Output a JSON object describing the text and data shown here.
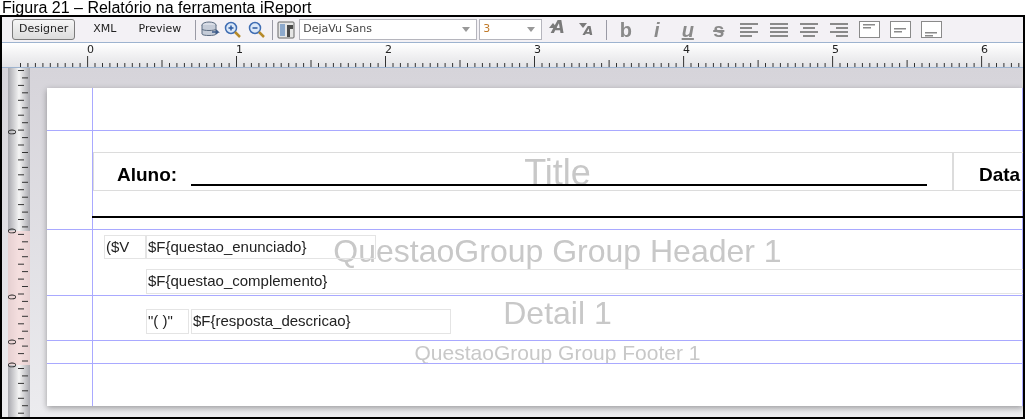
{
  "caption": "Figura 21 – Relatório na ferramenta iReport",
  "view_tabs": [
    {
      "label": "Designer",
      "selected": true
    },
    {
      "label": "XML",
      "selected": false
    },
    {
      "label": "Preview",
      "selected": false
    }
  ],
  "font_family": "DejaVu Sans",
  "font_size": "3",
  "font_size_buttons": [
    {
      "label": "A",
      "kind": "grow"
    },
    {
      "label": "A",
      "kind": "shrink"
    }
  ],
  "style_buttons": [
    {
      "label": "b",
      "kind": "bold"
    },
    {
      "label": "i",
      "kind": "italic"
    },
    {
      "label": "u",
      "kind": "underline"
    },
    {
      "label": "s",
      "kind": "strike"
    }
  ],
  "ruler_marks": [
    "0",
    "1",
    "2",
    "3",
    "4",
    "5",
    "6"
  ],
  "vertical_ruler_marks": [
    "0",
    "0",
    "0",
    "0",
    "0"
  ],
  "bands": [
    {
      "label": "Title"
    },
    {
      "label": "QuestaoGroup Group Header 1"
    },
    {
      "label": "Detail 1"
    },
    {
      "label": "QuestaoGroup Group Footer 1"
    }
  ],
  "elements": [
    {
      "text": "Aluno:",
      "kind": "label"
    },
    {
      "text": "Data",
      "kind": "label"
    },
    {
      "text": "($V",
      "kind": "field"
    },
    {
      "text": "$F{questao_enunciado}",
      "kind": "field"
    },
    {
      "text": "$F{questao_complemento}",
      "kind": "field"
    },
    {
      "text": "\"(  )\"",
      "kind": "field"
    },
    {
      "text": "$F{resposta_descricao}",
      "kind": "field"
    }
  ]
}
